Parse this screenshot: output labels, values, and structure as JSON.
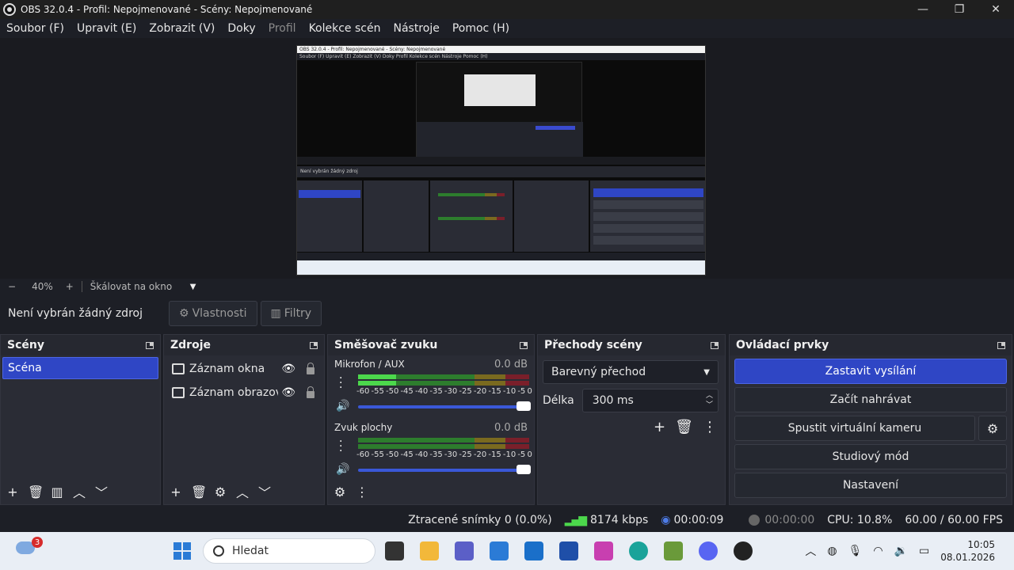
{
  "window": {
    "title": "OBS 32.0.4 - Profil: Nepojmenované - Scény: Nepojmenované",
    "minimize": "—",
    "maximize": "❐",
    "close": "✕"
  },
  "menu": {
    "items": [
      "Soubor (F)",
      "Upravit (E)",
      "Zobrazit (V)",
      "Doky",
      "Profil",
      "Kolekce scén",
      "Nástroje",
      "Pomoc (H)"
    ]
  },
  "preview": {
    "mini_title": "OBS 32.0.4 - Profil: Nepojmenované - Scény: Nepojmenované",
    "mini_menu": "Soubor (F)   Upravit (E)   Zobrazit (V)   Doky   Profil   Kolekce scén   Nástroje   Pomoc (H)",
    "mini_source": "Není vybrán žádný zdroj"
  },
  "zoom": {
    "minus": "−",
    "level": "40%",
    "plus": "+",
    "scale_mode": "Škálovat na okno",
    "dropdown": "▼"
  },
  "source_bar": {
    "no_source": "Není vybrán žádný zdroj",
    "properties": "Vlastnosti",
    "filters": "Filtry"
  },
  "scenes": {
    "title": "Scény",
    "items": [
      "Scéna"
    ],
    "toolbar": [
      "+",
      "🗑",
      "▥",
      "︿",
      "﹀"
    ]
  },
  "sources": {
    "title": "Zdroje",
    "items": [
      "Záznam okna",
      "Záznam obrazovky"
    ],
    "toolbar": [
      "+",
      "🗑",
      "⚙",
      "︿",
      "﹀"
    ]
  },
  "mixer": {
    "title": "Směšovač zvuku",
    "scale": [
      "-60",
      "-55",
      "-50",
      "-45",
      "-40",
      "-35",
      "-30",
      "-25",
      "-20",
      "-15",
      "-10",
      "-5",
      "0"
    ],
    "channels": [
      {
        "name": "Mikrofon / AUX",
        "db": "0.0 dB",
        "level": 0.22
      },
      {
        "name": "Zvuk plochy",
        "db": "0.0 dB",
        "level": 0.0
      }
    ],
    "toolbar": [
      "⚙",
      "⋮"
    ]
  },
  "transitions": {
    "title": "Přechody scény",
    "selected": "Barevný přechod",
    "duration_label": "Délka",
    "duration_value": "300 ms",
    "tools": [
      "+",
      "🗑",
      "⋮"
    ]
  },
  "controls": {
    "title": "Ovládací prvky",
    "stop_stream": "Zastavit vysílání",
    "start_record": "Začít nahrávat",
    "virtual_cam": "Spustit virtuální kameru",
    "studio_mode": "Studiový mód",
    "settings": "Nastavení"
  },
  "status": {
    "dropped": "Ztracené snímky 0 (0.0%)",
    "bitrate": "8174 kbps",
    "stream_time": "00:00:09",
    "record_time": "00:00:00",
    "cpu": "CPU: 10.8%",
    "fps": "60.00 / 60.00 FPS"
  },
  "taskbar": {
    "weather_badge": "3",
    "search_placeholder": "Hledat",
    "time": "10:05",
    "date": "08.01.2026"
  },
  "colors": {
    "accent": "#2f46c5",
    "meter_green": "#4cd84c",
    "meter_yellow": "#7a6a1f",
    "meter_red": "#7a1f2a"
  }
}
